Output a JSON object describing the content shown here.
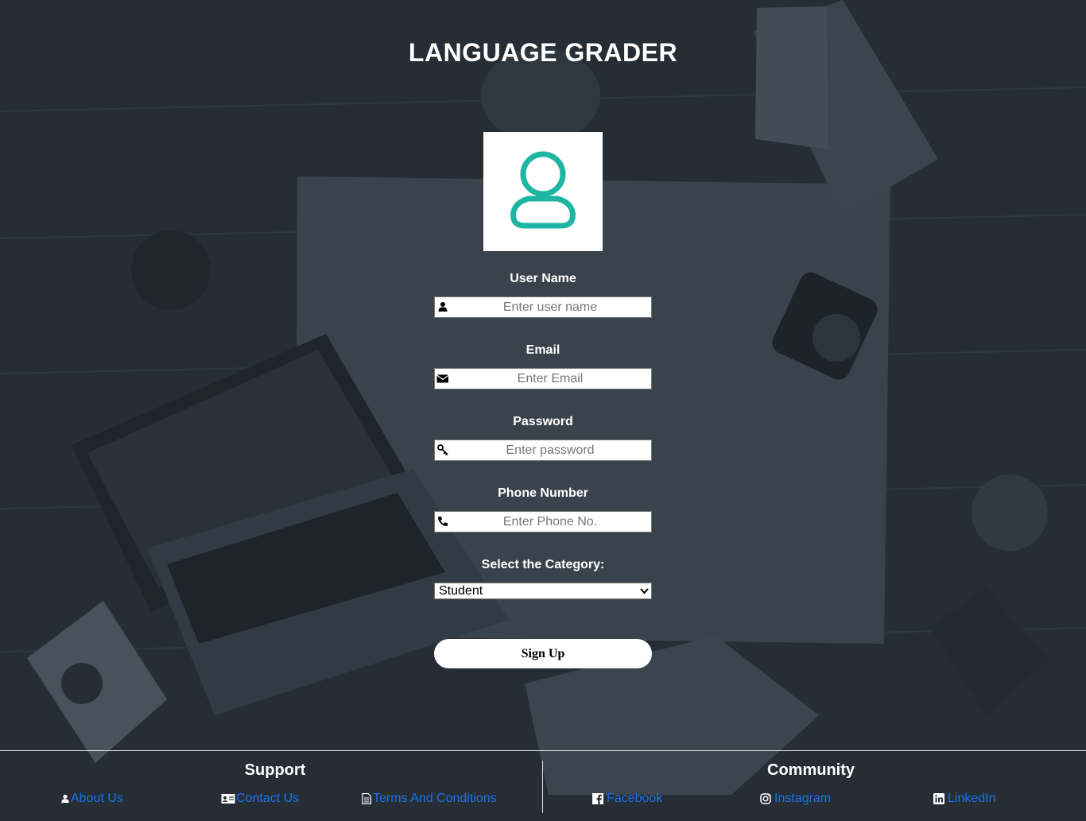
{
  "header": {
    "title": "LANGUAGE GRADER"
  },
  "form": {
    "username": {
      "label": "User Name",
      "placeholder": "Enter user name",
      "icon": "user-icon"
    },
    "email": {
      "label": "Email",
      "placeholder": "Enter Email",
      "icon": "envelope-icon"
    },
    "password": {
      "label": "Password",
      "placeholder": "Enter password",
      "icon": "key-icon"
    },
    "phone": {
      "label": "Phone Number",
      "placeholder": "Enter Phone No.",
      "icon": "phone-icon"
    },
    "category": {
      "label": "Select the Category:",
      "selected": "Student"
    },
    "submit_label": "Sign Up"
  },
  "footer": {
    "support": {
      "heading": "Support",
      "links": [
        {
          "label": "About Us",
          "icon": "user-icon"
        },
        {
          "label": "Contact Us",
          "icon": "contact-card-icon"
        },
        {
          "label": "Terms And Conditions",
          "icon": "document-icon"
        }
      ]
    },
    "community": {
      "heading": "Community",
      "links": [
        {
          "label": "Facebook",
          "icon": "facebook-icon"
        },
        {
          "label": "Instagram",
          "icon": "instagram-icon"
        },
        {
          "label": "LinkedIn",
          "icon": "linkedin-icon"
        }
      ]
    }
  },
  "colors": {
    "background": "#262d35",
    "accent_teal": "#1fb5a3",
    "link": "#1a73e8",
    "text": "#ffffff"
  }
}
